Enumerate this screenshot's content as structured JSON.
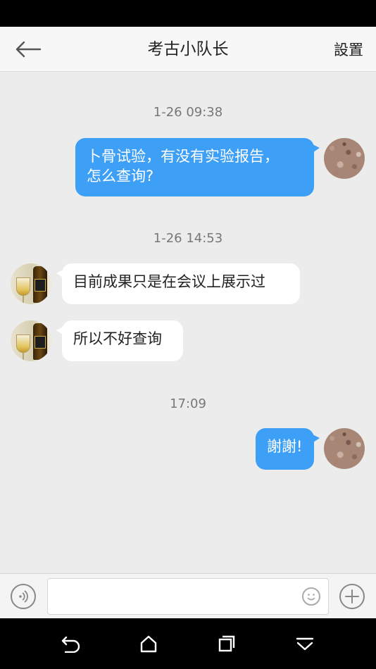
{
  "header": {
    "title": "考古小队长",
    "settings_label": "設置"
  },
  "messages": [
    {
      "timestamp": "1-26 09:38"
    },
    {
      "direction": "outgoing",
      "line1": "卜骨试验，有没有实验报告，",
      "line2": "怎么查询?"
    },
    {
      "timestamp": "1-26 14:53"
    },
    {
      "direction": "incoming",
      "text": "目前成果只是在会议上展示过"
    },
    {
      "direction": "incoming",
      "text": "所以不好查询"
    },
    {
      "timestamp": "17:09"
    },
    {
      "direction": "outgoing",
      "text": "謝謝!"
    }
  ],
  "input": {
    "value": "",
    "placeholder": ""
  },
  "icons": {
    "back": "arrow-left-icon",
    "voice": "voice-icon",
    "emoji": "smiley-icon",
    "plus": "plus-icon",
    "nav_back": "undo-arrow-icon",
    "nav_home": "home-icon",
    "nav_recents": "recents-icon",
    "nav_collapse": "collapse-icon"
  },
  "colors": {
    "outgoing_bubble": "#3d9ff5",
    "incoming_bubble": "#ffffff",
    "chat_background": "#ececec"
  }
}
